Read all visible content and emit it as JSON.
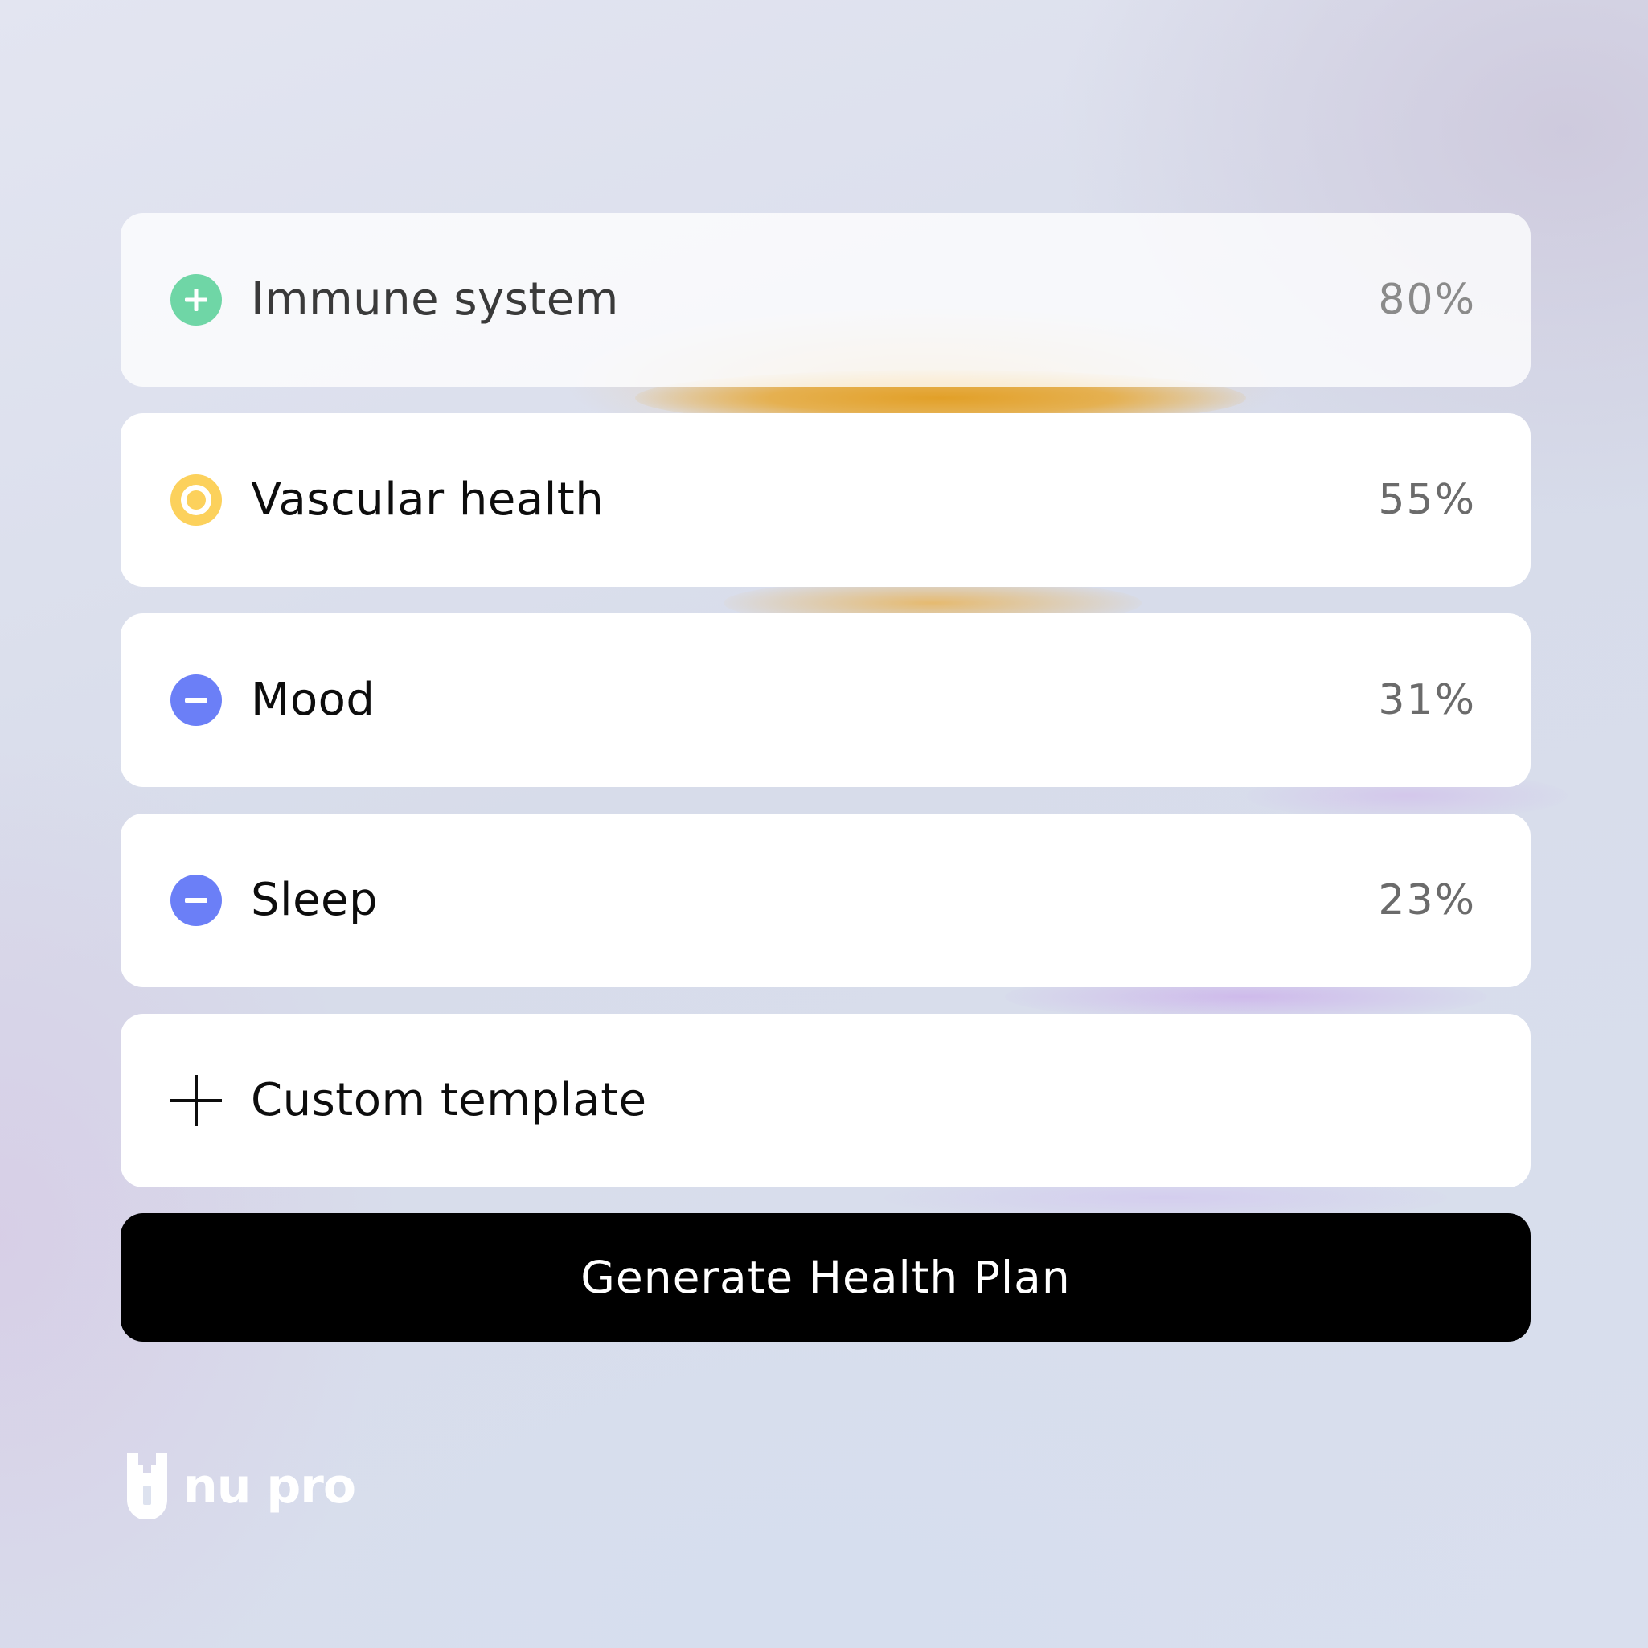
{
  "items": [
    {
      "label": "Immune system",
      "value": "80%",
      "status": "positive",
      "icon": "plus-circle-icon",
      "color": "#6fd6a6"
    },
    {
      "label": "Vascular health",
      "value": "55%",
      "status": "neutral",
      "icon": "ring-icon",
      "color": "#fcd15c"
    },
    {
      "label": "Mood",
      "value": "31%",
      "status": "negative",
      "icon": "minus-circle-icon",
      "color": "#6b7ff7"
    },
    {
      "label": "Sleep",
      "value": "23%",
      "status": "negative",
      "icon": "minus-circle-icon",
      "color": "#6b7ff7"
    }
  ],
  "custom_template": {
    "label": "Custom template",
    "icon": "plus-icon"
  },
  "primary_button": {
    "label": "Generate Health Plan"
  },
  "brand": {
    "name": "nu pro",
    "icon": "nu-pro-logo-icon"
  },
  "colors": {
    "positive": "#6fd6a6",
    "neutral": "#fcd15c",
    "negative": "#6b7ff7",
    "button_bg": "#000000"
  }
}
